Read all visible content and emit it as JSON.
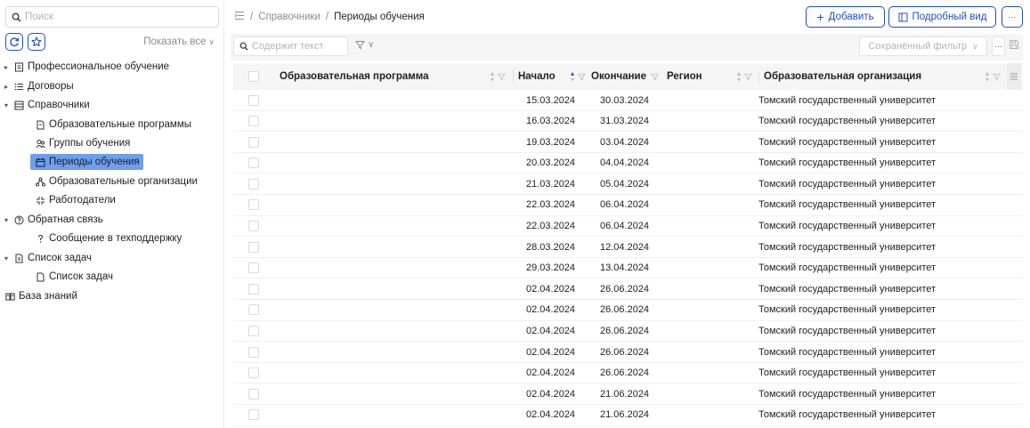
{
  "sidebar": {
    "search_placeholder": "Поиск",
    "show_all_label": "Показать все",
    "items": [
      {
        "label": "Профессиональное обучение",
        "arrow": "▸",
        "icon": "book-icon"
      },
      {
        "label": "Договоры",
        "arrow": "▸",
        "icon": "list-icon"
      },
      {
        "label": "Справочники",
        "arrow": "▾",
        "icon": "catalog-icon"
      },
      {
        "label": "Образовательные программы",
        "arrow": "",
        "icon": "document-icon"
      },
      {
        "label": "Группы обучения",
        "arrow": "",
        "icon": "group-icon"
      },
      {
        "label": "Периоды обучения",
        "arrow": "",
        "icon": "calendar-icon",
        "active": true
      },
      {
        "label": "Образовательные организации",
        "arrow": "",
        "icon": "organization-icon"
      },
      {
        "label": "Работодатели",
        "arrow": "",
        "icon": "employer-icon"
      },
      {
        "label": "Обратная связь",
        "arrow": "▾",
        "icon": "question-circle-icon"
      },
      {
        "label": "Сообщение в техподдержку",
        "arrow": "",
        "icon": "question-icon"
      },
      {
        "label": "Список задач",
        "arrow": "▾",
        "icon": "tasks-icon"
      },
      {
        "label": "Список задач",
        "arrow": "",
        "icon": "document-icon"
      },
      {
        "label": "База знаний",
        "arrow": "",
        "icon": "knowledge-base-icon"
      }
    ]
  },
  "header": {
    "breadcrumb": [
      "Справочники",
      "Периоды обучения"
    ],
    "add_button": "Добавить",
    "detail_view_button": "Подробный вид",
    "more_button": "···"
  },
  "toolbar": {
    "filter_placeholder": "Содержит текст",
    "saved_filter_placeholder": "Сохранённый фильтр",
    "more_label": "···"
  },
  "table": {
    "columns": [
      "Образовательная программа",
      "Начало",
      "Окончание",
      "Регион",
      "Образовательная организация"
    ],
    "sorted_column": "Начало",
    "rows": [
      {
        "program": "",
        "start": "15.03.2024",
        "end": "30.03.2024",
        "region": "",
        "org": "Томский государственный университет"
      },
      {
        "program": "",
        "start": "16.03.2024",
        "end": "31.03.2024",
        "region": "",
        "org": "Томский государственный университет"
      },
      {
        "program": "",
        "start": "19.03.2024",
        "end": "03.04.2024",
        "region": "",
        "org": "Томский государственный университет"
      },
      {
        "program": "",
        "start": "20.03.2024",
        "end": "04.04.2024",
        "region": "",
        "org": "Томский государственный университет"
      },
      {
        "program": "",
        "start": "21.03.2024",
        "end": "05.04.2024",
        "region": "",
        "org": "Томский государственный университет"
      },
      {
        "program": "",
        "start": "22.03.2024",
        "end": "06.04.2024",
        "region": "",
        "org": "Томский государственный университет"
      },
      {
        "program": "",
        "start": "22.03.2024",
        "end": "06.04.2024",
        "region": "",
        "org": "Томский государственный университет"
      },
      {
        "program": "",
        "start": "28.03.2024",
        "end": "12.04.2024",
        "region": "",
        "org": "Томский государственный университет"
      },
      {
        "program": "",
        "start": "29.03.2024",
        "end": "13.04.2024",
        "region": "",
        "org": "Томский государственный университет"
      },
      {
        "program": "",
        "start": "02.04.2024",
        "end": "26.06.2024",
        "region": "",
        "org": "Томский государственный университет"
      },
      {
        "program": "",
        "start": "02.04.2024",
        "end": "26.06.2024",
        "region": "",
        "org": "Томский государственный университет"
      },
      {
        "program": "",
        "start": "02.04.2024",
        "end": "26.06.2024",
        "region": "",
        "org": "Томский государственный университет"
      },
      {
        "program": "",
        "start": "02.04.2024",
        "end": "26.06.2024",
        "region": "",
        "org": "Томский государственный университет"
      },
      {
        "program": "",
        "start": "02.04.2024",
        "end": "26.06.2024",
        "region": "",
        "org": "Томский государственный университет"
      },
      {
        "program": "",
        "start": "02.04.2024",
        "end": "21.06.2024",
        "region": "",
        "org": "Томский государственный университет"
      },
      {
        "program": "",
        "start": "02.04.2024",
        "end": "21.06.2024",
        "region": "",
        "org": "Томский государственный университет"
      }
    ]
  },
  "colors": {
    "accent": "#1f4fc4",
    "active_item_bg": "#6e9ef0",
    "header_bg": "#f5f5f5",
    "muted_text": "#8c8c8c"
  }
}
